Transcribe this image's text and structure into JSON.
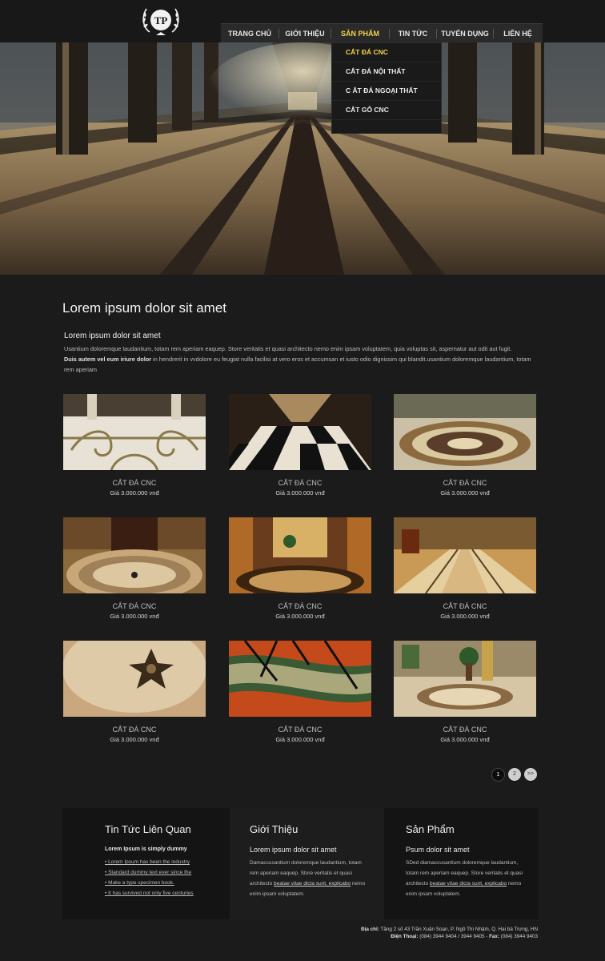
{
  "header": {
    "logo_text": "TP",
    "nav": [
      {
        "label": "TRANG CHỦ",
        "active": false
      },
      {
        "label": "GIỚI THIỆU",
        "active": false
      },
      {
        "label": "SẢN PHẨM",
        "active": true
      },
      {
        "label": "TIN TỨC",
        "active": false
      },
      {
        "label": "TUYỂN DỤNG",
        "active": false
      },
      {
        "label": "LIÊN HỆ",
        "active": false
      }
    ],
    "dropdown": [
      {
        "label": "CẮT ĐÁ CNC",
        "active": true
      },
      {
        "label": "CẮT ĐÁ NỘI THẤT",
        "active": false
      },
      {
        "label": "C ẮT ĐÁ NGOẠI THẤT",
        "active": false
      },
      {
        "label": "CẮT GỖ CNC",
        "active": false
      }
    ]
  },
  "main": {
    "title": "Lorem ipsum dolor sit amet",
    "intro_title": "Lorem ipsum dolor sit amet",
    "intro_p1": "Usantium doloremque laudantium, totam rem aperiam eaquep. Store veritatis et quasi architecto nemo enim ipsam voluptatem, quia voluptas sit, aspernatur aut odit aut fugit.",
    "intro_bold": "Duis autem vel eum iriure dolor",
    "intro_p2": " in hendrerit in vvdolore eu feugiat nulla facilisi at vero eros et accumsan et iusto odio dignissim qui blandit.usantium doloremque laudantium, totam rem aperiam"
  },
  "products": [
    {
      "name": "CẮT ĐÁ CNC",
      "price": "Giá 3.000.000 vnđ"
    },
    {
      "name": "CẮT ĐÁ CNC",
      "price": "Giá 3.000.000 vnđ"
    },
    {
      "name": "CẮT ĐÁ CNC",
      "price": "Giá 3.000.000 vnđ"
    },
    {
      "name": "CẮT ĐÁ CNC",
      "price": "Giá 3.000.000 vnđ"
    },
    {
      "name": "CẮT ĐÁ CNC",
      "price": "Giá 3.000.000 vnđ"
    },
    {
      "name": "CẮT ĐÁ CNC",
      "price": "Giá 3.000.000 vnđ"
    },
    {
      "name": "CẮT ĐÁ CNC",
      "price": "Giá 3.000.000 vnđ"
    },
    {
      "name": "CẮT ĐÁ CNC",
      "price": "Giá 3.000.000 vnđ"
    },
    {
      "name": "CẮT ĐÁ CNC",
      "price": "Giá 3.000.000 vnđ"
    }
  ],
  "pagination": {
    "pages": [
      "1",
      "2",
      ">>"
    ],
    "current": "1"
  },
  "footer": {
    "news": {
      "title": "Tin Tức Liên Quan",
      "subtitle": "Lorem Ipsum is simply dummy",
      "links": [
        "Lorem Ipsum has been the industry",
        "Standard dummy text ever since the",
        "Make a type specimen book.",
        "It has survived not only five centuries"
      ]
    },
    "about": {
      "title": "Giới Thiệu",
      "subtitle": "Lorem ipsum dolor sit amet",
      "text1": "Damaccusantium doloremque laudantium, totam rem aperiam eaquep. Store veritatis et quasi architecto ",
      "link": "beatae vitae dicta sunt, explicabo",
      "text2": " nemo enim ipsam voluptatem."
    },
    "products": {
      "title": "Sản Phẩm",
      "subtitle": "Psum dolor sit amet",
      "text1": "SDed diamaccusantium doloremque laudantium, totam rem aperiam eaquep. Store veritatis et quasi architecto ",
      "link": "beatae vitae dicta sunt, explicabo",
      "text2": " nemo enim ipsam voluptatem."
    },
    "address_label": "Địa chỉ:",
    "address": " Tầng 2 số 43 Trần Xuân Soạn, P. Ngô Thì Nhậm, Q. Hai bà Trưng, HN",
    "phone_label": "Điện Thoại:",
    "phone": " (084) 3944 9404 / 3944 9405 - ",
    "fax_label": "Fax:",
    "fax": " (084) 3944 9403"
  },
  "colors": {
    "accent": "#f3d24a",
    "background": "#1b1b1b",
    "nav_bg": "#2a2a2a"
  }
}
